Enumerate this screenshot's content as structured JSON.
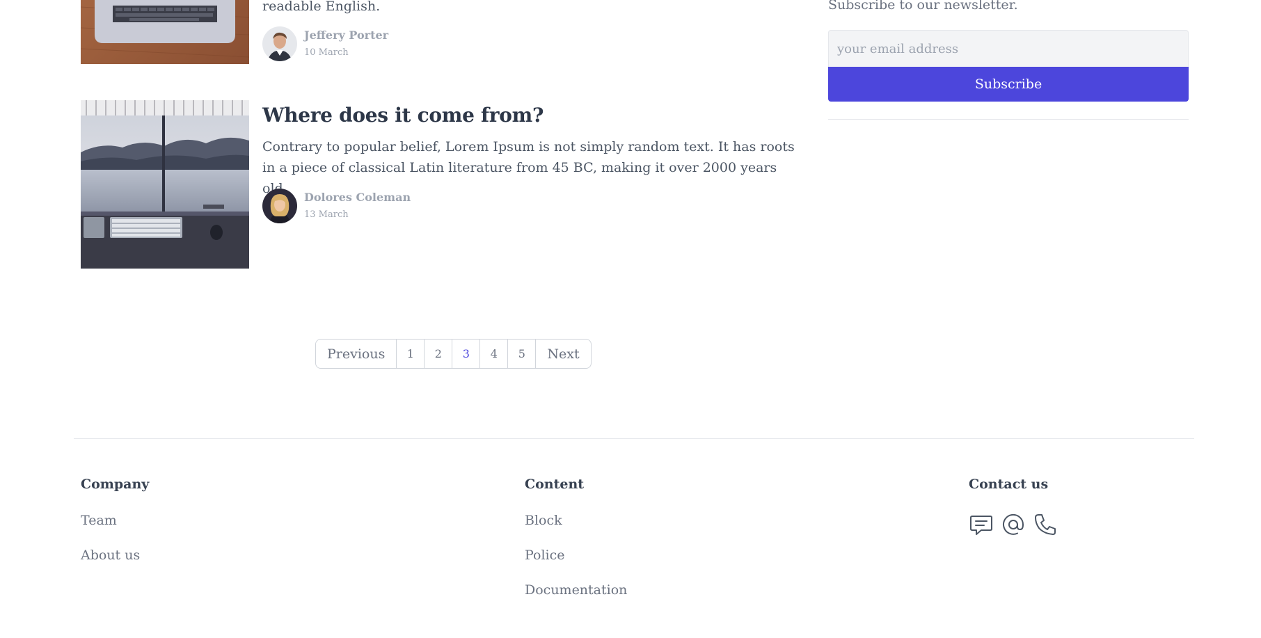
{
  "posts": [
    {
      "title": "",
      "excerpt_tail": "readable English.",
      "author": "Jeffery Porter",
      "date": "10 March",
      "thumb_icon": "laptop-on-wood-image"
    },
    {
      "title": "Where does it come from?",
      "excerpt": "Contrary to popular belief, Lorem Ipsum is not simply random text. It has roots in a piece of classical Latin literature from 45 BC, making it over 2000 years old.",
      "author": "Dolores Coleman",
      "date": "13 March",
      "thumb_icon": "desk-monitors-lake-image"
    }
  ],
  "sidebar": {
    "newsletter_text": "Subscribe to our newsletter.",
    "email_placeholder": "your email address",
    "subscribe_label": "Subscribe"
  },
  "pagination": {
    "previous_label": "Previous",
    "next_label": "Next",
    "pages": [
      "1",
      "2",
      "3",
      "4",
      "5"
    ],
    "current_page": "3"
  },
  "footer": {
    "company": {
      "heading": "Company",
      "links": [
        "Team",
        "About us"
      ]
    },
    "content": {
      "heading": "Content",
      "links": [
        "Block",
        "Police",
        "Documentation"
      ]
    },
    "contact": {
      "heading": "Contact us",
      "icons": [
        "chat-icon",
        "at-icon",
        "phone-icon"
      ]
    }
  },
  "colors": {
    "accent": "#4c46dc",
    "text": "#374151",
    "muted": "#6b7280"
  }
}
